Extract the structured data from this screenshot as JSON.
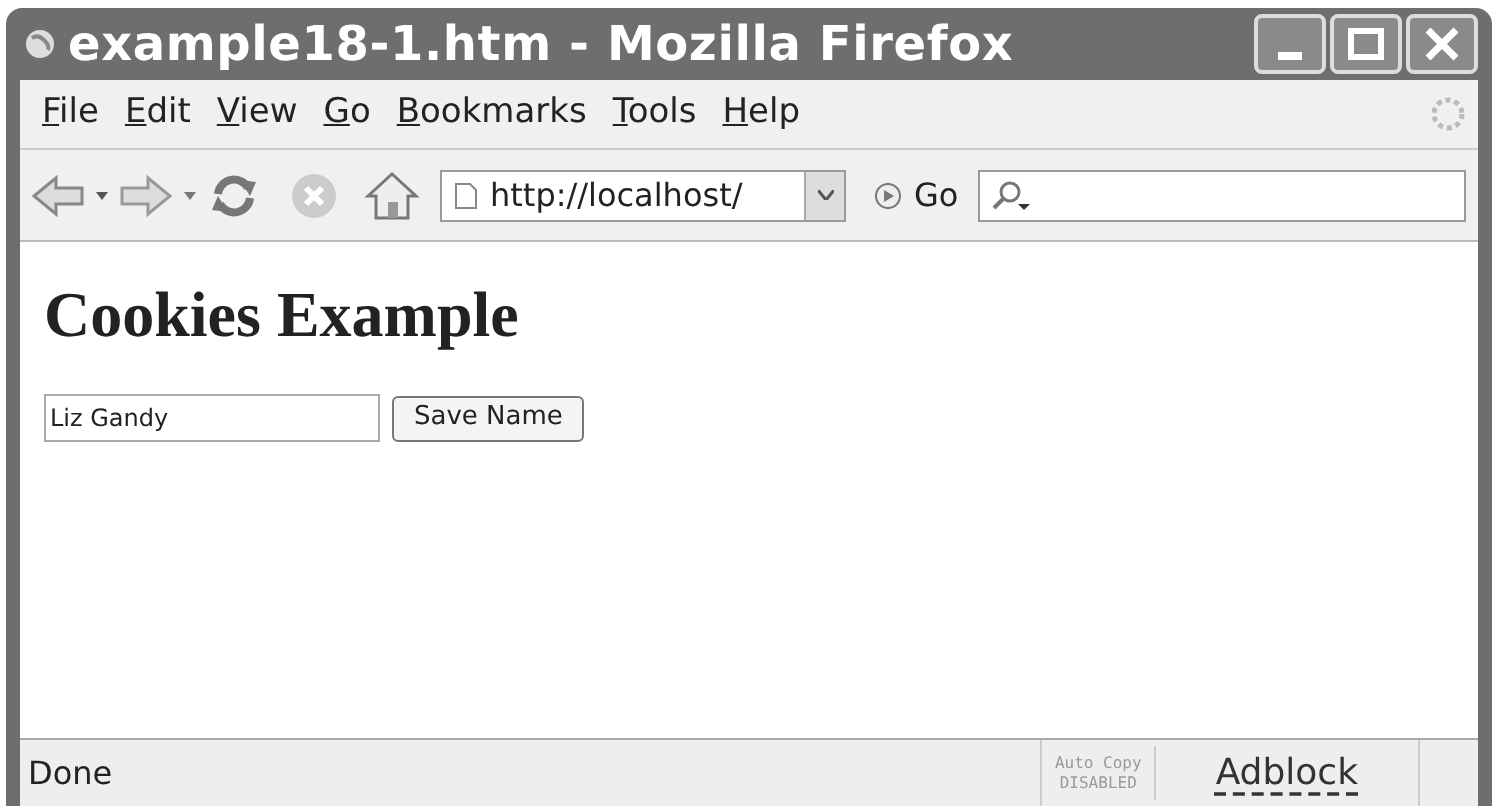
{
  "window": {
    "title": "example18-1.htm - Mozilla Firefox"
  },
  "menu": [
    "File",
    "Edit",
    "View",
    "Go",
    "Bookmarks",
    "Tools",
    "Help"
  ],
  "toolbar": {
    "url": "http://localhost/",
    "go": "Go"
  },
  "page": {
    "heading": "Cookies Example",
    "name_field": {
      "value": "Liz Gandy"
    },
    "button": "Save Name"
  },
  "status_bar": {
    "text": "Done",
    "auto_copy": [
      "Auto Copy",
      "DISABLED"
    ],
    "adblock": "Adblock"
  }
}
